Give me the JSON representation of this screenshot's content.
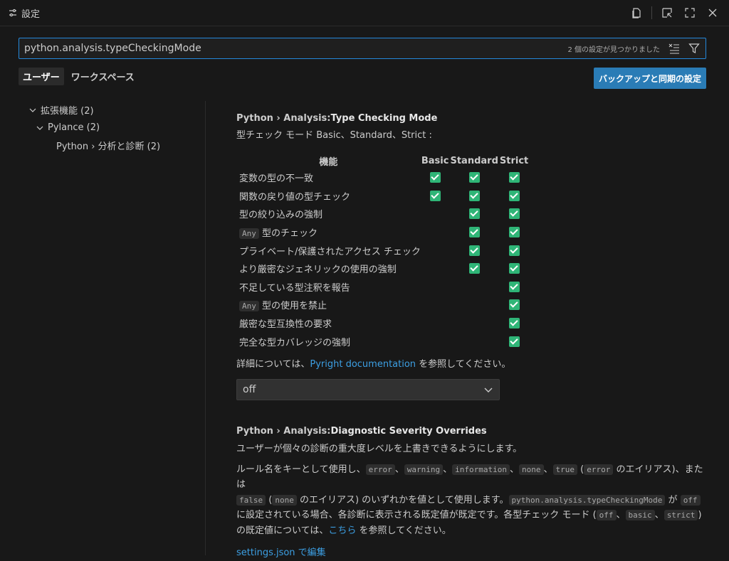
{
  "tab": {
    "title": "設定"
  },
  "search": {
    "value": "python.analysis.typeCheckingMode",
    "count": "2 個の設定が見つかりました"
  },
  "scope": {
    "user": "ユーザー",
    "workspace": "ワークスペース"
  },
  "sync_button": "バックアップと同期の設定",
  "toc": [
    {
      "label": "拡張機能 (2)"
    },
    {
      "label": "Pylance (2)"
    },
    {
      "label": "Python › 分析と診断 (2)"
    }
  ],
  "setting1": {
    "category": "Python › Analysis: ",
    "key": "Type Checking Mode",
    "desc": "型チェック モード Basic、Standard、Strict :",
    "header": {
      "feature": "機能",
      "basic": "Basic",
      "standard": "Standard",
      "strict": "Strict"
    },
    "rows": [
      {
        "pre": "",
        "label": "変数の型の不一致",
        "basic": true,
        "standard": true,
        "strict": true
      },
      {
        "pre": "",
        "label": "関数の戻り値の型チェック",
        "basic": true,
        "standard": true,
        "strict": true
      },
      {
        "pre": "",
        "label": "型の絞り込みの強制",
        "basic": false,
        "standard": true,
        "strict": true
      },
      {
        "pre": "Any",
        "label": " 型のチェック",
        "basic": false,
        "standard": true,
        "strict": true
      },
      {
        "pre": "",
        "label": "プライベート/保護されたアクセス チェック",
        "basic": false,
        "standard": true,
        "strict": true
      },
      {
        "pre": "",
        "label": "より厳密なジェネリックの使用の強制",
        "basic": false,
        "standard": true,
        "strict": true
      },
      {
        "pre": "",
        "label": "不足している型注釈を報告",
        "basic": false,
        "standard": false,
        "strict": true
      },
      {
        "pre": "Any",
        "label": " 型の使用を禁止",
        "basic": false,
        "standard": false,
        "strict": true
      },
      {
        "pre": "",
        "label": "厳密な型互換性の要求",
        "basic": false,
        "standard": false,
        "strict": true
      },
      {
        "pre": "",
        "label": "完全な型カバレッジの強制",
        "basic": false,
        "standard": false,
        "strict": true
      }
    ],
    "more_pre": "詳細については、",
    "more_link": "Pyright documentation",
    "more_post": " を参照してください。",
    "select_value": "off"
  },
  "setting2": {
    "category": "Python › Analysis: ",
    "key": "Diagnostic Severity Overrides",
    "desc": "ユーザーが個々の診断の重大度レベルを上書きできるようにします。",
    "p1_a": "ルール名をキーとして使用し、",
    "c_error": "error",
    "sep": "、",
    "c_warning": "warning",
    "c_information": "information",
    "c_none": "none",
    "c_true": "true",
    "p1_b": " (",
    "p1_c": " のエイリアス)、または",
    "c_false": "false",
    "p1_d": " のエイリアス) のいずれかを値として使用します。",
    "c_setting": "python.analysis.typeCheckingMode",
    "p1_e": " が ",
    "c_off": "off",
    "p1_f": "に設定されている場合、各診断に表示される既定値が既定です。各型チェック モード (",
    "c_basic": "basic",
    "c_strict": "strict",
    "p1_g": ")",
    "p1_h": "の既定値については、",
    "link_here": "こちら",
    "p1_i": " を参照してください。",
    "edit_link": "settings.json で編集"
  }
}
